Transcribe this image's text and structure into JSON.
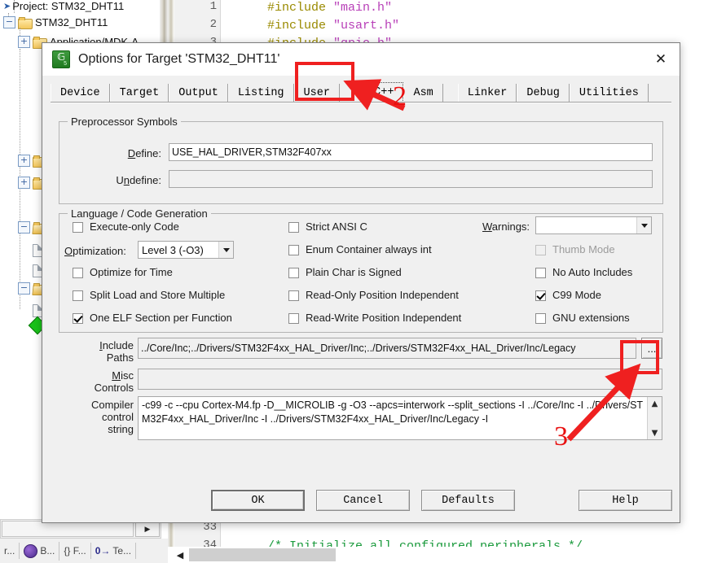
{
  "ide": {
    "tree": [
      {
        "label": "Project: STM32_DHT11",
        "icon": "project-arrow-icon",
        "indent": 0,
        "expander": ""
      },
      {
        "label": "STM32_DHT11",
        "icon": "target-folder-icon",
        "indent": 1,
        "expander": "-"
      },
      {
        "label": "Application/MDK-A",
        "icon": "folder-icon",
        "indent": 2,
        "expander": "+"
      }
    ],
    "editor": {
      "lines": [
        {
          "num": "1",
          "text": "#include \"main.h\""
        },
        {
          "num": "2",
          "text": "#include \"usart.h\""
        },
        {
          "num": "3",
          "text": "#include \"gpio.h\""
        }
      ],
      "bottom_lines": [
        {
          "num": "33",
          "text": ""
        },
        {
          "num": "34",
          "text": "/* Initialize all configured peripherals */"
        }
      ]
    },
    "bottom_tabs": [
      {
        "label": "r...",
        "icon": ""
      },
      {
        "label": "B...",
        "icon": "books-icon"
      },
      {
        "label": "{} F...",
        "icon": ""
      },
      {
        "label": "Te...",
        "icon": "0-arrow-icon"
      }
    ]
  },
  "dialog": {
    "title": "Options for Target 'STM32_DHT11'",
    "app_icon": "keil-uvision-icon",
    "close_icon": "close-icon",
    "tabs": [
      {
        "label": "Device",
        "selected": false
      },
      {
        "label": "Target",
        "selected": false
      },
      {
        "label": "Output",
        "selected": false
      },
      {
        "label": "Listing",
        "selected": false
      },
      {
        "label": "User",
        "selected": false
      },
      {
        "label": "C/C++",
        "selected": true
      },
      {
        "label": "Asm",
        "selected": false
      },
      {
        "label": "Linker",
        "selected": false
      },
      {
        "label": "Debug",
        "selected": false
      },
      {
        "label": "Utilities",
        "selected": false
      }
    ],
    "preprocessor": {
      "group_title": "Preprocessor Symbols",
      "define_label": "Define:",
      "define_value": "USE_HAL_DRIVER,STM32F407xx",
      "undefine_label": "Undefine:",
      "undefine_value": ""
    },
    "language": {
      "group_title": "Language / Code Generation",
      "left_checks": [
        {
          "label": "Execute-only Code",
          "checked": false,
          "disabled": false
        },
        {
          "label": "Optimize for Time",
          "checked": false,
          "disabled": false
        },
        {
          "label": "Split Load and Store Multiple",
          "checked": false,
          "disabled": false
        },
        {
          "label": "One ELF Section per Function",
          "checked": true,
          "disabled": false
        }
      ],
      "optimization_label": "Optimization:",
      "optimization_value": "Level 3 (-O3)",
      "mid_checks": [
        {
          "label": "Strict ANSI C",
          "checked": false,
          "disabled": false
        },
        {
          "label": "Enum Container always int",
          "checked": false,
          "disabled": false
        },
        {
          "label": "Plain Char is Signed",
          "checked": false,
          "disabled": false
        },
        {
          "label": "Read-Only Position Independent",
          "checked": false,
          "disabled": false
        },
        {
          "label": "Read-Write Position Independent",
          "checked": false,
          "disabled": false
        }
      ],
      "warnings_label": "Warnings:",
      "warnings_value": "",
      "right_checks": [
        {
          "label": "Thumb Mode",
          "checked": false,
          "disabled": true
        },
        {
          "label": "No Auto Includes",
          "checked": false,
          "disabled": false
        },
        {
          "label": "C99 Mode",
          "checked": true,
          "disabled": false
        },
        {
          "label": "GNU extensions",
          "checked": false,
          "disabled": false
        }
      ]
    },
    "paths": {
      "include_label_line1": "Include",
      "include_label_line2": "Paths",
      "include_value": "../Core/Inc;../Drivers/STM32F4xx_HAL_Driver/Inc;../Drivers/STM32F4xx_HAL_Driver/Inc/Legacy",
      "browse_button_label": "...",
      "misc_label_line1": "Misc",
      "misc_label_line2": "Controls",
      "misc_value": "",
      "compiler_label_line1": "Compiler",
      "compiler_label_line2": "control",
      "compiler_label_line3": "string",
      "compiler_value": "-c99 -c --cpu Cortex-M4.fp -D__MICROLIB -g -O3 --apcs=interwork --split_sections -I ../Core/Inc -I ../Drivers/STM32F4xx_HAL_Driver/Inc -I ../Drivers/STM32F4xx_HAL_Driver/Inc/Legacy -I",
      "scroll_up_icon": "chevron-up-icon",
      "scroll_down_icon": "chevron-down-icon"
    },
    "buttons": [
      {
        "label": "OK",
        "default": true
      },
      {
        "label": "Cancel",
        "default": false
      },
      {
        "label": "Defaults",
        "default": false
      },
      {
        "label": "Help",
        "default": false
      }
    ]
  },
  "annotations": {
    "marker_2": "2",
    "marker_3": "3",
    "highlight_color": "#ef2020"
  }
}
